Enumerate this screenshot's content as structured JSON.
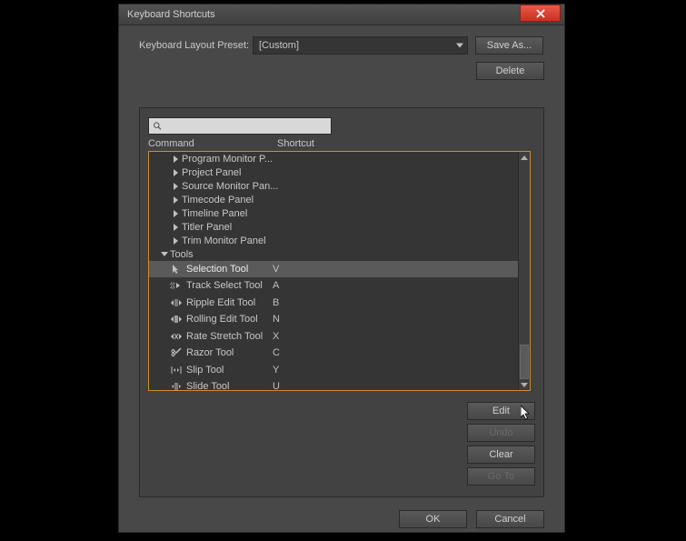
{
  "window": {
    "title": "Keyboard Shortcuts"
  },
  "preset": {
    "label": "Keyboard Layout Preset:",
    "value": "[Custom]"
  },
  "buttons": {
    "save_as": "Save As...",
    "delete": "Delete",
    "edit": "Edit",
    "undo": "Undo",
    "clear": "Clear",
    "goto": "Go To",
    "ok": "OK",
    "cancel": "Cancel"
  },
  "columns": {
    "command": "Command",
    "shortcut": "Shortcut"
  },
  "search": {
    "placeholder": ""
  },
  "tree": {
    "panels": [
      {
        "label": "Program Monitor P..."
      },
      {
        "label": "Project Panel"
      },
      {
        "label": "Source Monitor Pan..."
      },
      {
        "label": "Timecode Panel"
      },
      {
        "label": "Timeline Panel"
      },
      {
        "label": "Titler Panel"
      },
      {
        "label": "Trim Monitor Panel"
      }
    ],
    "tools_label": "Tools",
    "tools": [
      {
        "label": "Selection Tool",
        "shortcut": "V",
        "icon": "cursor",
        "selected": true
      },
      {
        "label": "Track Select Tool",
        "shortcut": "A",
        "icon": "track-select"
      },
      {
        "label": "Ripple Edit Tool",
        "shortcut": "B",
        "icon": "ripple"
      },
      {
        "label": "Rolling Edit Tool",
        "shortcut": "N",
        "icon": "rolling"
      },
      {
        "label": "Rate Stretch Tool",
        "shortcut": "X",
        "icon": "rate-stretch"
      },
      {
        "label": "Razor Tool",
        "shortcut": "C",
        "icon": "razor"
      },
      {
        "label": "Slip Tool",
        "shortcut": "Y",
        "icon": "slip"
      },
      {
        "label": "Slide Tool",
        "shortcut": "U",
        "icon": "slide"
      }
    ]
  }
}
